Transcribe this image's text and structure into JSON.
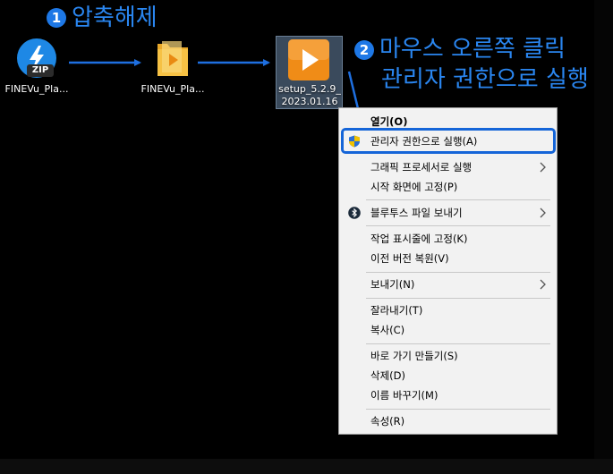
{
  "annotations": {
    "step1": {
      "number": "1",
      "text": "압축해제"
    },
    "step2": {
      "number": "2",
      "line1": "마우스 오른쪽 클릭",
      "line2": "관리자 권한으로 실행"
    }
  },
  "desktop": {
    "icons": [
      {
        "name": "zip-file",
        "label": "FINEVu_Pla...",
        "badge": "ZIP"
      },
      {
        "name": "extracted-folder",
        "label": "FINEVu_Pla..."
      },
      {
        "name": "setup-exe",
        "label_line1": "setup_5.2.9_",
        "label_line2": "2023.01.16",
        "selected": true
      }
    ]
  },
  "context_menu": {
    "items": [
      {
        "id": "open",
        "label": "열기(O)",
        "bold": true
      },
      {
        "id": "run-as-admin",
        "label": "관리자 권한으로 실행(A)",
        "icon": "uac-shield-icon",
        "highlighted": true
      },
      {
        "id": "run-with-gpu",
        "label": "그래픽 프로세서로 실행",
        "submenu": true
      },
      {
        "id": "pin-start",
        "label": "시작 화면에 고정(P)"
      },
      {
        "id": "bluetooth-send",
        "label": "블루투스 파일 보내기",
        "icon": "bluetooth-icon",
        "submenu": true
      },
      {
        "id": "pin-taskbar",
        "label": "작업 표시줄에 고정(K)"
      },
      {
        "id": "restore-prev",
        "label": "이전 버전 복원(V)"
      },
      {
        "id": "send-to",
        "label": "보내기(N)",
        "submenu": true
      },
      {
        "id": "cut",
        "label": "잘라내기(T)"
      },
      {
        "id": "copy",
        "label": "복사(C)"
      },
      {
        "id": "create-shortcut",
        "label": "바로 가기 만들기(S)"
      },
      {
        "id": "delete",
        "label": "삭제(D)"
      },
      {
        "id": "rename",
        "label": "이름 바꾸기(M)"
      },
      {
        "id": "properties",
        "label": "속성(R)"
      }
    ]
  },
  "colors": {
    "annotation_blue": "#2a86f0",
    "highlight_border": "#1565d8",
    "menu_bg": "#f2f2f2"
  }
}
